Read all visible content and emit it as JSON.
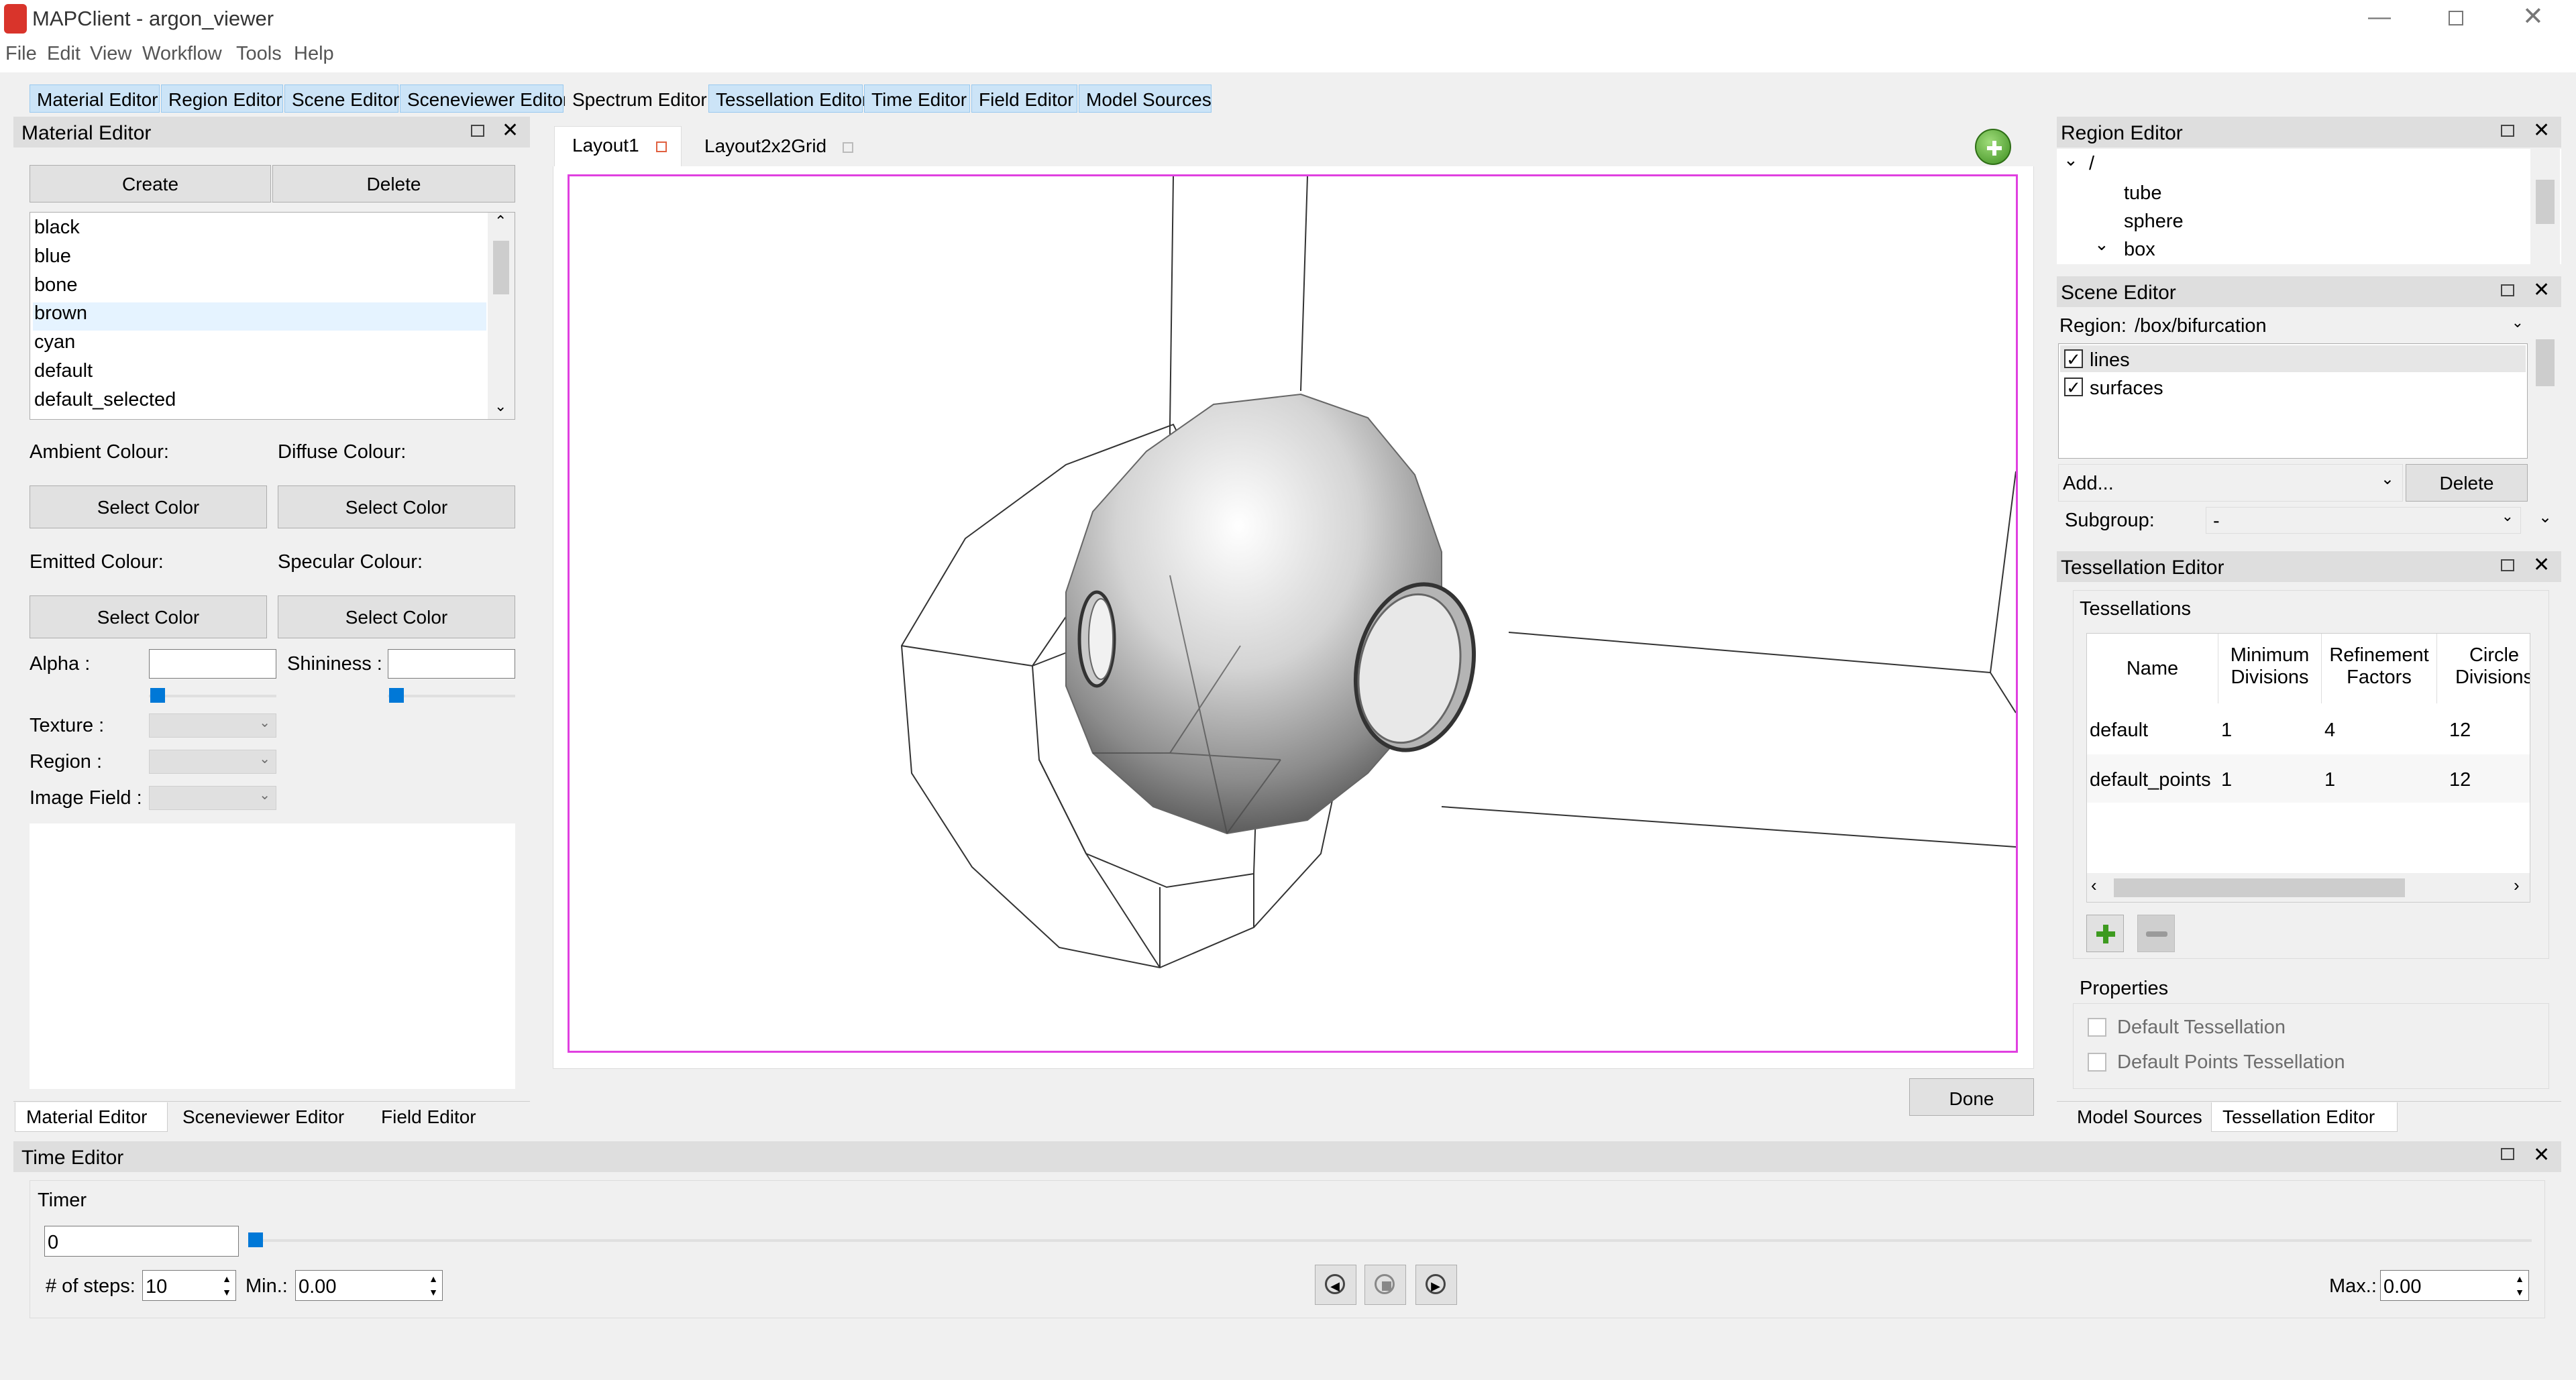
{
  "window": {
    "title": "MAPClient - argon_viewer"
  },
  "menu": [
    "File",
    "Edit",
    "View",
    "Workflow",
    "Tools",
    "Help"
  ],
  "top_tabs": [
    "Material Editor",
    "Region Editor",
    "Scene Editor",
    "Sceneviewer Editor",
    "Spectrum Editor",
    "Tessellation Editor",
    "Time Editor",
    "Field Editor",
    "Model Sources"
  ],
  "material_editor": {
    "title": "Material Editor",
    "create": "Create",
    "delete": "Delete",
    "materials": [
      "black",
      "blue",
      "bone",
      "brown",
      "cyan",
      "default",
      "default_selected"
    ],
    "selected_material": "brown",
    "ambient_label": "Ambient Colour:",
    "diffuse_label": "Diffuse Colour:",
    "emitted_label": "Emitted Colour:",
    "specular_label": "Specular Colour:",
    "select_color": "Select Color",
    "alpha_label": "Alpha :",
    "shininess_label": "Shininess :",
    "texture_label": "Texture :",
    "region_label": "Region :",
    "image_field_label": "Image Field :"
  },
  "left_bottom_tabs": [
    "Material Editor",
    "Sceneviewer Editor",
    "Field Editor"
  ],
  "viewer": {
    "tabs": [
      "Layout1",
      "Layout2x2Grid"
    ],
    "done": "Done"
  },
  "region_editor": {
    "title": "Region Editor",
    "tree": [
      "/",
      "tube",
      "sphere",
      "box"
    ]
  },
  "scene_editor": {
    "title": "Scene Editor",
    "region_label": "Region:",
    "region_value": "/box/bifurcation",
    "graphics": [
      "lines",
      "surfaces"
    ],
    "add_label": "Add...",
    "delete": "Delete",
    "subgroup_label": "Subgroup:",
    "subgroup_value": "-"
  },
  "tessellation_editor": {
    "title": "Tessellation Editor",
    "group_label": "Tessellations",
    "headers": [
      "Name",
      "Minimum Divisions",
      "Refinement Factors",
      "Circle Divisions"
    ],
    "rows": [
      [
        "default",
        "1",
        "4",
        "12"
      ],
      [
        "default_points",
        "1",
        "1",
        "12"
      ]
    ],
    "properties_label": "Properties",
    "default_tessellation": "Default Tessellation",
    "default_points_tessellation": "Default Points Tessellation"
  },
  "right_bottom_tabs": [
    "Model Sources",
    "Tessellation Editor"
  ],
  "time_editor": {
    "title": "Time Editor",
    "timer_label": "Timer",
    "timer_value": "0",
    "steps_label": "# of steps:",
    "steps_value": "10",
    "min_label": "Min.:",
    "min_value": "0.00",
    "max_label": "Max.:",
    "max_value": "0.00"
  },
  "colors": {
    "accent": "#0078d7",
    "viewport_border": "#e040e0",
    "tab_bg": "#cce4f7"
  }
}
